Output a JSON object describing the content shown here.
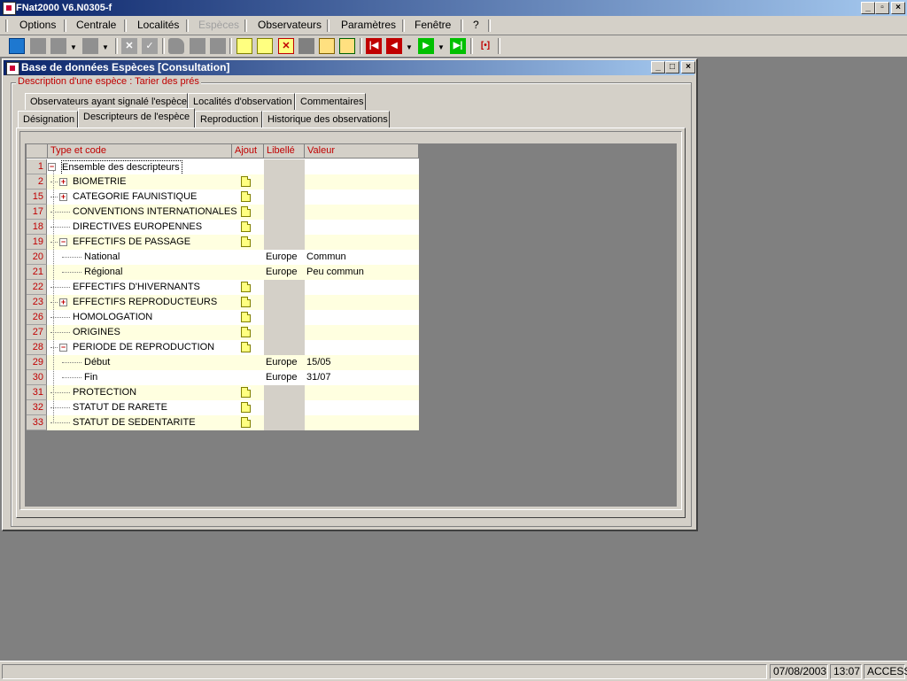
{
  "app": {
    "title": "FNat2000 V6.N0305-f"
  },
  "menu": [
    "Options",
    "Centrale",
    "Localités",
    "Espèces",
    "Observateurs",
    "Paramètres",
    "Fenêtre",
    "?"
  ],
  "toolbar_icons": [
    "refresh-icon",
    "new-icon",
    "copy-icon",
    "print-icon",
    "cancel-icon",
    "validate-icon",
    "open-icon",
    "save-icon",
    "delete-icon",
    "find-icon",
    "export-icon",
    "import-icon",
    "first-icon",
    "prev-icon",
    "next-icon",
    "last-icon",
    "close-record-icon"
  ],
  "window": {
    "title": "Base de données Espèces [Consultation]"
  },
  "group": {
    "label": "Description d'une espèce : Tarier des prés"
  },
  "tabs_row1": [
    "Observateurs ayant signalé l'espèce",
    "Localités d'observation",
    "Commentaires"
  ],
  "tabs_row2": [
    "Désignation",
    "Descripteurs de l'espèce",
    "Reproduction",
    "Historique des observations"
  ],
  "active_tab": "Descripteurs de l'espèce",
  "grid": {
    "headers": [
      "Type et code",
      "Ajout",
      "Libellé",
      "Valeur"
    ],
    "rows": [
      {
        "num": "1",
        "label": "Ensemble des descripteurs",
        "level": 0,
        "expander": "−",
        "note": false,
        "libelle": "",
        "valeur": ""
      },
      {
        "num": "2",
        "label": "BIOMETRIE",
        "level": 1,
        "expander": "+",
        "note": true,
        "libelle": "",
        "valeur": ""
      },
      {
        "num": "15",
        "label": "CATEGORIE FAUNISTIQUE",
        "level": 1,
        "expander": "+",
        "note": true,
        "libelle": "",
        "valeur": ""
      },
      {
        "num": "17",
        "label": "CONVENTIONS INTERNATIONALES",
        "level": 1,
        "expander": "",
        "note": true,
        "libelle": "",
        "valeur": ""
      },
      {
        "num": "18",
        "label": "DIRECTIVES EUROPENNES",
        "level": 1,
        "expander": "",
        "note": true,
        "libelle": "",
        "valeur": ""
      },
      {
        "num": "19",
        "label": "EFFECTIFS DE PASSAGE",
        "level": 1,
        "expander": "−",
        "note": true,
        "libelle": "",
        "valeur": ""
      },
      {
        "num": "20",
        "label": "National",
        "level": 2,
        "expander": "",
        "note": false,
        "libelle": "Europe",
        "valeur": "Commun"
      },
      {
        "num": "21",
        "label": "Régional",
        "level": 2,
        "expander": "",
        "note": false,
        "libelle": "Europe",
        "valeur": "Peu commun"
      },
      {
        "num": "22",
        "label": "EFFECTIFS D'HIVERNANTS",
        "level": 1,
        "expander": "",
        "note": true,
        "libelle": "",
        "valeur": ""
      },
      {
        "num": "23",
        "label": "EFFECTIFS REPRODUCTEURS",
        "level": 1,
        "expander": "+",
        "note": true,
        "libelle": "",
        "valeur": ""
      },
      {
        "num": "26",
        "label": "HOMOLOGATION",
        "level": 1,
        "expander": "",
        "note": true,
        "libelle": "",
        "valeur": ""
      },
      {
        "num": "27",
        "label": "ORIGINES",
        "level": 1,
        "expander": "",
        "note": true,
        "libelle": "",
        "valeur": ""
      },
      {
        "num": "28",
        "label": "PERIODE DE REPRODUCTION",
        "level": 1,
        "expander": "−",
        "note": true,
        "libelle": "",
        "valeur": ""
      },
      {
        "num": "29",
        "label": "Début",
        "level": 2,
        "expander": "",
        "note": false,
        "libelle": "Europe",
        "valeur": "15/05"
      },
      {
        "num": "30",
        "label": "Fin",
        "level": 2,
        "expander": "",
        "note": false,
        "libelle": "Europe",
        "valeur": "31/07"
      },
      {
        "num": "31",
        "label": "PROTECTION",
        "level": 1,
        "expander": "",
        "note": true,
        "libelle": "",
        "valeur": ""
      },
      {
        "num": "32",
        "label": "STATUT DE RARETE",
        "level": 1,
        "expander": "",
        "note": true,
        "libelle": "",
        "valeur": ""
      },
      {
        "num": "33",
        "label": "STATUT DE SEDENTARITE",
        "level": 1,
        "expander": "",
        "note": true,
        "libelle": "",
        "valeur": ""
      }
    ]
  },
  "status": {
    "date": "07/08/2003",
    "time": "13:07",
    "mode": "ACCESS"
  },
  "colors": {
    "header_text": "#c00000",
    "row_alt": "#ffffe0",
    "title_gradient_start": "#0a246a",
    "title_gradient_end": "#a6caf0"
  }
}
